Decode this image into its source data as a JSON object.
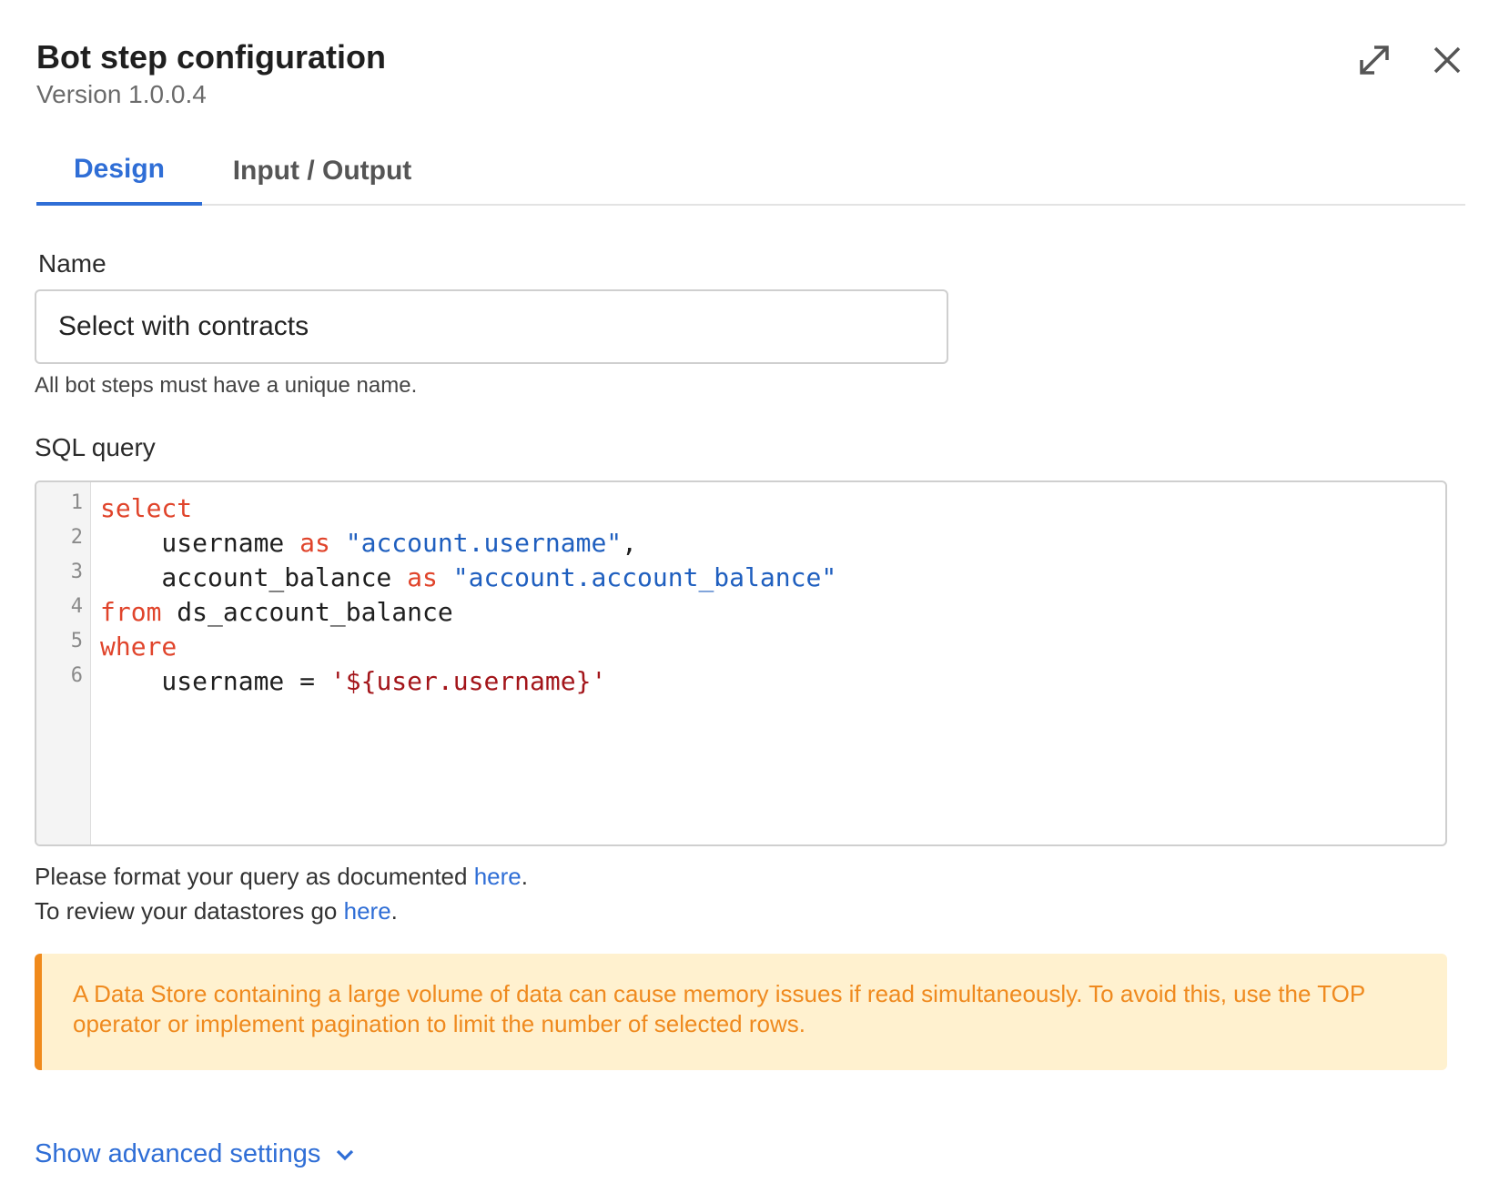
{
  "header": {
    "title": "Bot step configuration",
    "version": "Version 1.0.0.4"
  },
  "tabs": [
    {
      "label": "Design",
      "active": true
    },
    {
      "label": "Input / Output",
      "active": false
    }
  ],
  "name_field": {
    "label": "Name",
    "value": "Select with contracts",
    "helper": "All bot steps must have a unique name."
  },
  "sql": {
    "label": "SQL query",
    "line_numbers": [
      "1",
      "2",
      "3",
      "4",
      "5",
      "6"
    ],
    "lines": [
      [
        {
          "t": "select",
          "c": "kw"
        }
      ],
      [
        {
          "t": "    username ",
          "c": ""
        },
        {
          "t": "as",
          "c": "kw"
        },
        {
          "t": " ",
          "c": ""
        },
        {
          "t": "\"account.username\"",
          "c": "str"
        },
        {
          "t": ",",
          "c": ""
        }
      ],
      [
        {
          "t": "    account_balance ",
          "c": ""
        },
        {
          "t": "as",
          "c": "kw"
        },
        {
          "t": " ",
          "c": ""
        },
        {
          "t": "\"account.account_balance\"",
          "c": "str"
        }
      ],
      [
        {
          "t": "from",
          "c": "kw"
        },
        {
          "t": " ds_account_balance",
          "c": ""
        }
      ],
      [
        {
          "t": "where",
          "c": "kw"
        }
      ],
      [
        {
          "t": "    username = ",
          "c": ""
        },
        {
          "t": "'${user.username}'",
          "c": "str2"
        }
      ]
    ]
  },
  "docs": {
    "line1_prefix": "Please format your query as documented ",
    "line1_link": "here",
    "line1_suffix": ".",
    "line2_prefix": "To review your datastores go ",
    "line2_link": "here",
    "line2_suffix": "."
  },
  "warning": {
    "text": "A Data Store containing a large volume of data can cause memory issues if read simultaneously. To avoid this, use the TOP operator or implement pagination to limit the number of selected rows."
  },
  "advanced": {
    "label": "Show advanced settings"
  },
  "icons": {
    "expand": "expand-icon",
    "close": "close-icon",
    "chevron": "chevron-down-icon"
  },
  "colors": {
    "accent": "#2f6ed6",
    "keyword": "#e0442b",
    "string": "#1f5fbf",
    "warning_bg": "#fff1cf",
    "warning_text": "#ef8a1f"
  }
}
